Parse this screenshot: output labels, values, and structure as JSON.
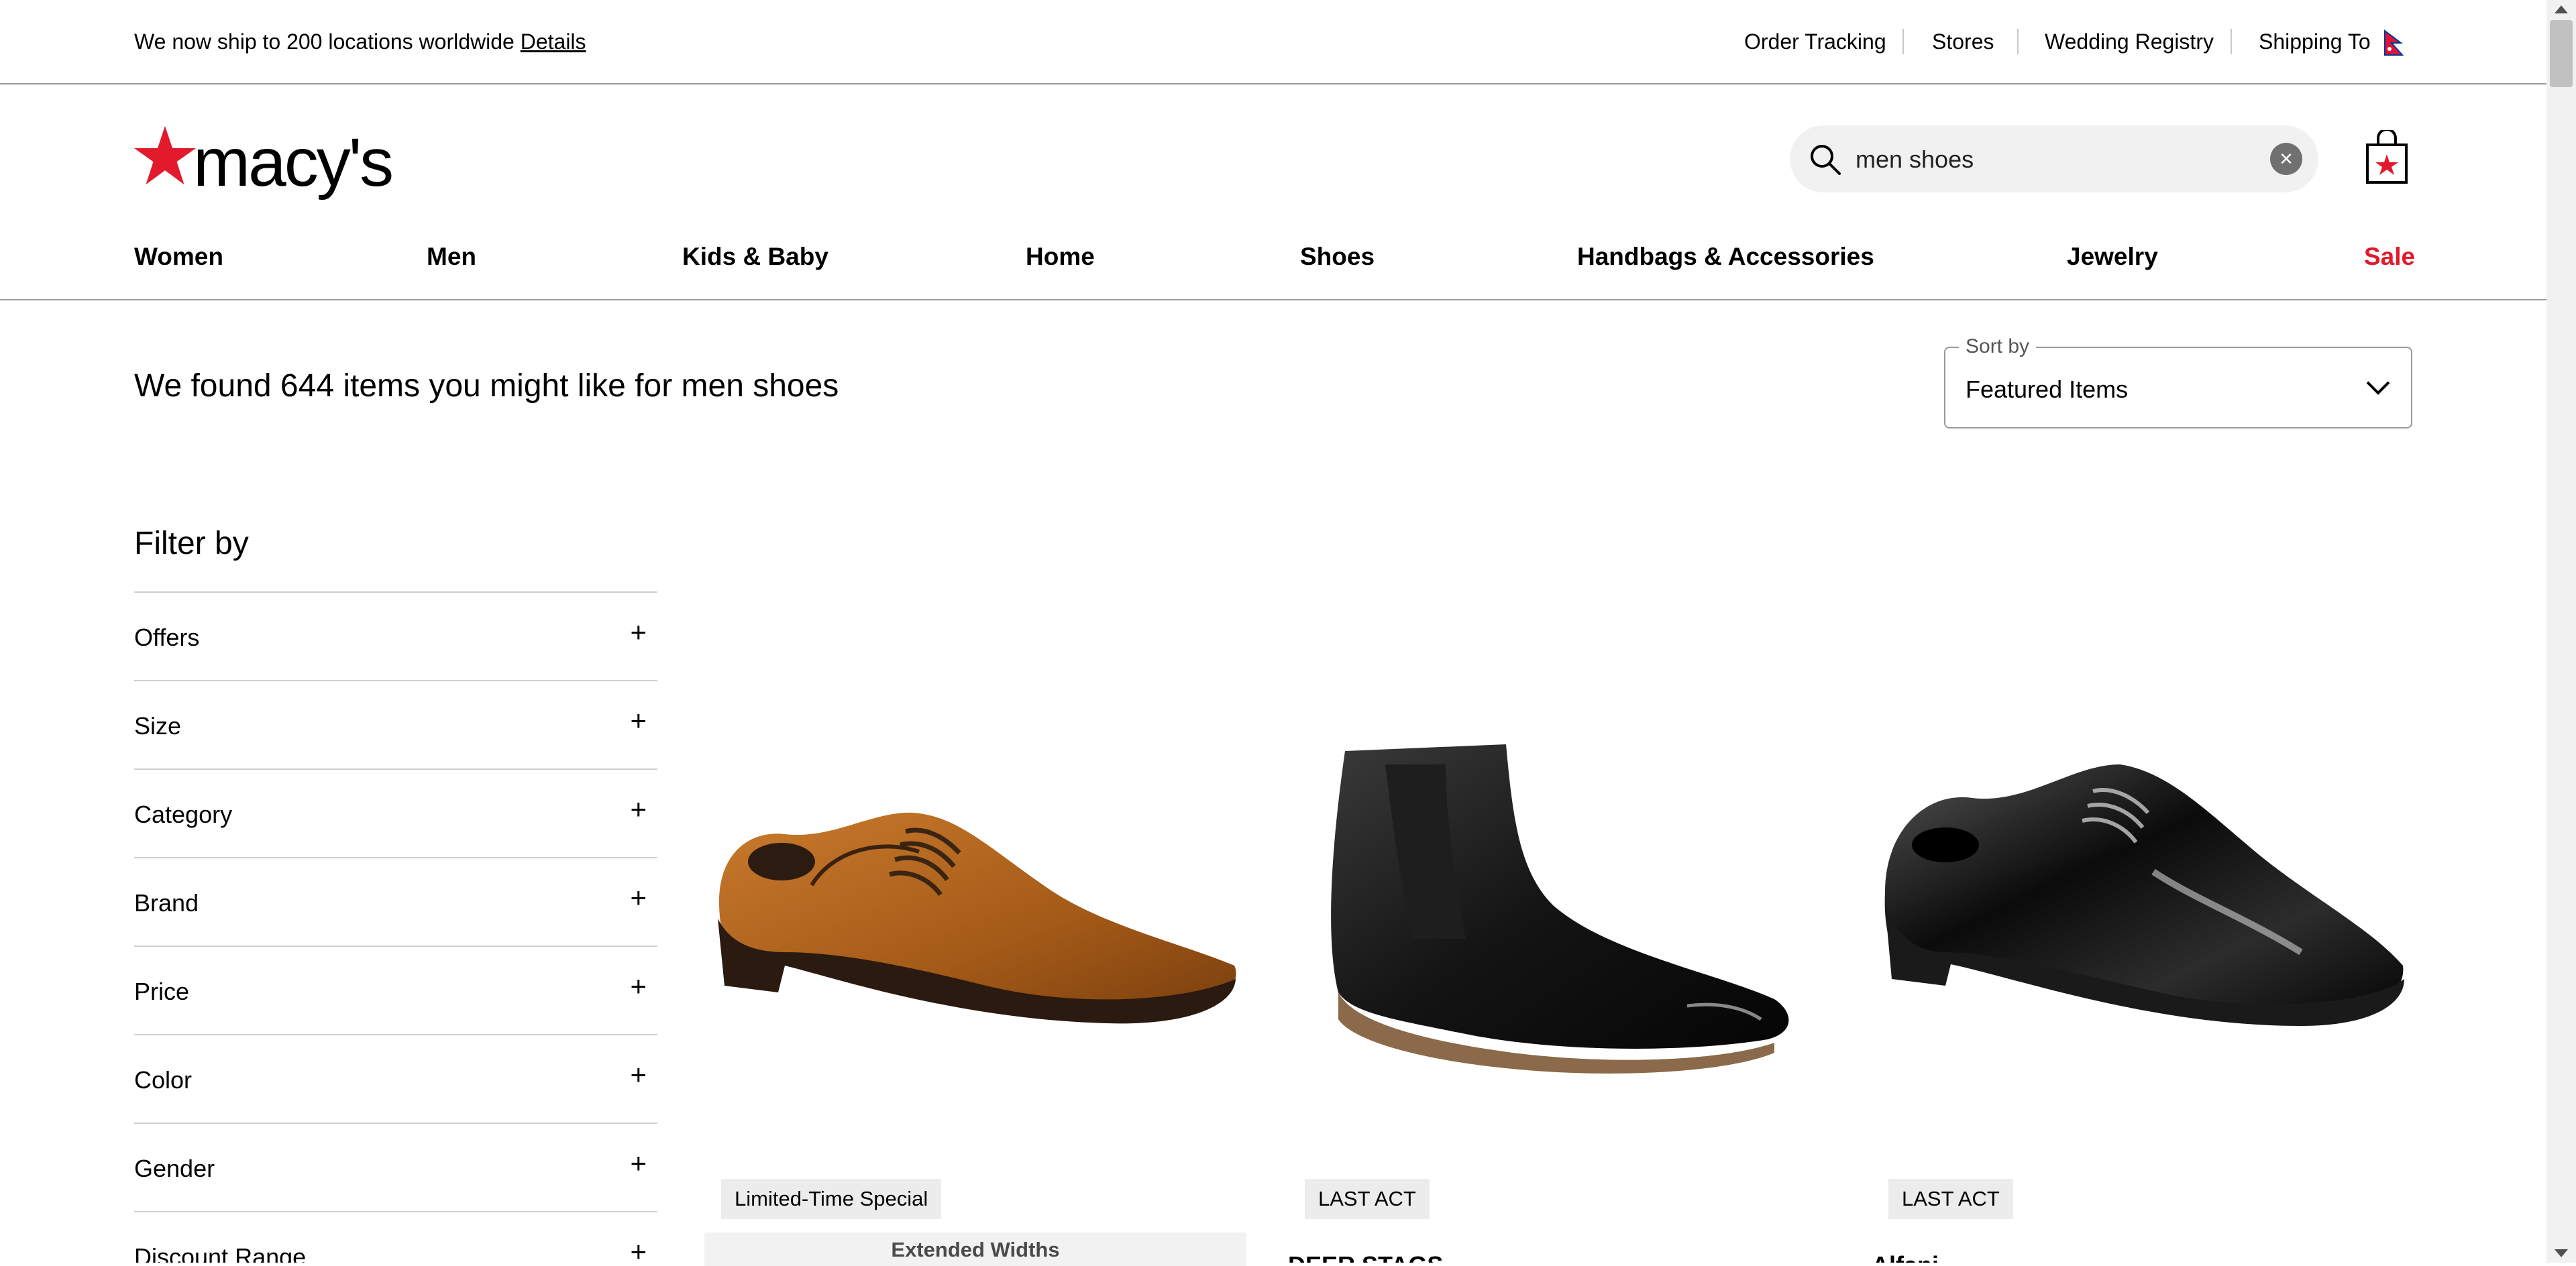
{
  "topbar": {
    "ship_text": "We now ship to 200 locations worldwide",
    "details_link": "Details",
    "links": [
      "Order Tracking",
      "Stores",
      "Wedding Registry",
      "Shipping To"
    ]
  },
  "brand": {
    "logo_text": "macy's",
    "accent": "#e21a2c"
  },
  "search": {
    "value": "men shoes",
    "clear_icon": "close-icon"
  },
  "nav": [
    "Women",
    "Men",
    "Kids & Baby",
    "Home",
    "Shoes",
    "Handbags & Accessories",
    "Jewelry",
    "Sale"
  ],
  "results": {
    "heading": "We found 644 items you might like for men shoes"
  },
  "sort": {
    "label": "Sort by",
    "value": "Featured Items"
  },
  "filter": {
    "title": "Filter by",
    "sections": [
      "Offers",
      "Size",
      "Category",
      "Brand",
      "Price",
      "Color",
      "Gender",
      "Discount Range"
    ]
  },
  "products": [
    {
      "badge": "Limited-Time Special",
      "extra": "Extended Widths",
      "image": "brown-oxford-shoe"
    },
    {
      "badge": "LAST ACT",
      "title_cut": "DEER STAGS",
      "image": "black-chelsea-boot"
    },
    {
      "badge": "LAST ACT",
      "title_cut": "Alfani",
      "image": "black-patent-oxford"
    }
  ]
}
